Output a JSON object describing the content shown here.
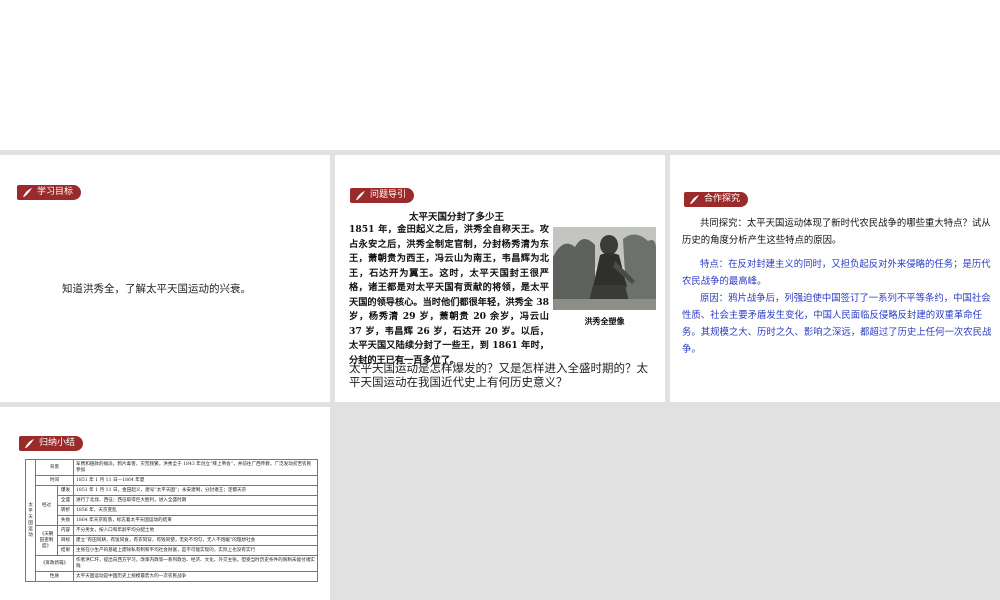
{
  "slides": {
    "goals": {
      "tag_label": "学习目标",
      "text": "知道洪秀全，了解太平天国运动的兴衰。"
    },
    "question": {
      "tag_label": "问题导引",
      "reading_title": "太平天国分封了多少王",
      "reading_body": "1851 年，金田起义之后，洪秀全自称天王。攻占永安之后，洪秀全制定官制，分封杨秀清为东王，萧朝贵为西王，冯云山为南王，韦昌辉为北王，石达开为翼王。这时，太平天国封王很严格，诸王都是对太平天国有贡献的将领，是太平天国的领导核心。当时他们都很年轻，洪秀全 38 岁，杨秀清 29 岁，萧朝贵 20 余岁，冯云山 37 岁，韦昌辉 26 岁，石达开 20 岁。以后，太平天国又陆续分封了一些王，到 1861 年时，分封的王已有一百多位了。",
      "photo_caption": "洪秀全塑像",
      "bottom_question": "太平天国运动是怎样爆发的？又是怎样进入全盛时期的？太平天国运动在我国近代史上有何历史意义？"
    },
    "cooperation": {
      "tag_label": "合作探究",
      "question": "共同探究：太平天国运动体现了新时代农民战争的哪些重大特点？试从历史的角度分析产生这些特点的原因。",
      "answer_features": "特点：在反对封建主义的同时，又担负起反对外来侵略的任务；是历代农民战争的最高峰。",
      "answer_reasons": "原因：鸦片战争后，列强迫使中国签订了一系列不平等条约，中国社会性质、社会主要矛盾发生变化，中国人民面临反侵略反封建的双重革命任务。其规模之大、历时之久、影响之深远，都超过了历史上任何一次农民战争。"
    },
    "summary": {
      "tag_label": "归纳小结",
      "side_label": "太平天国运动",
      "rows": {
        "background_key": "背景",
        "background_val": "军费和赔款的摊派，鸦片毒害，灾荒频繁，洪秀全于 1843 年创立“拜上帝会”，并前往广西传教，广泛发动贫苦农民参加",
        "time_key": "时间",
        "time_val": "1851 年 1 月 11 日—1864 年夏",
        "process_key": "经过",
        "outbreak_key": "爆发",
        "outbreak_val": "1851 年 1 月 11 日，金田起义，建号“太平天国”；永安建制，分封诸王；定都天京",
        "peak_key": "全盛",
        "peak_val": "进行了北伐、西征；西征取得巨大胜利，进入全盛时期",
        "turn_key": "转折",
        "turn_val": "1856 年，天京变乱",
        "fail_key": "失败",
        "fail_val": "1864 年天京陷落，标志着太平天国运动的结束",
        "land_key": "《天朝田亩制度》",
        "content_key": "内容",
        "content_val": "不分男女，按人口和年龄平均分配土地",
        "goal_key": "目标",
        "goal_val": "建立“有田同耕，有饭同食，有衣同穿，有钱同使，无处不均匀，无人不饱暖”的理想社会",
        "result_key": "结果",
        "result_val": "主张在小生产的基础上废除私有制和平均社会财富，是不可能实现的，实际上也没有实行",
        "newbook_key": "《资政新篇》",
        "newbook_val": "作者洪仁玕，提出向西方学习，改革内政等一系列政治、经济、文化、外交主张，但受当时历史条件的限制未能付诸实践",
        "nature_key": "性质",
        "nature_val": "太平天国运动是中国历史上规模最宏大的一次农民战争"
      }
    }
  },
  "colors": {
    "tag_bg": "#9b2a2a",
    "answer_text": "#2b3bc4",
    "gap": "#e1e1e1"
  }
}
